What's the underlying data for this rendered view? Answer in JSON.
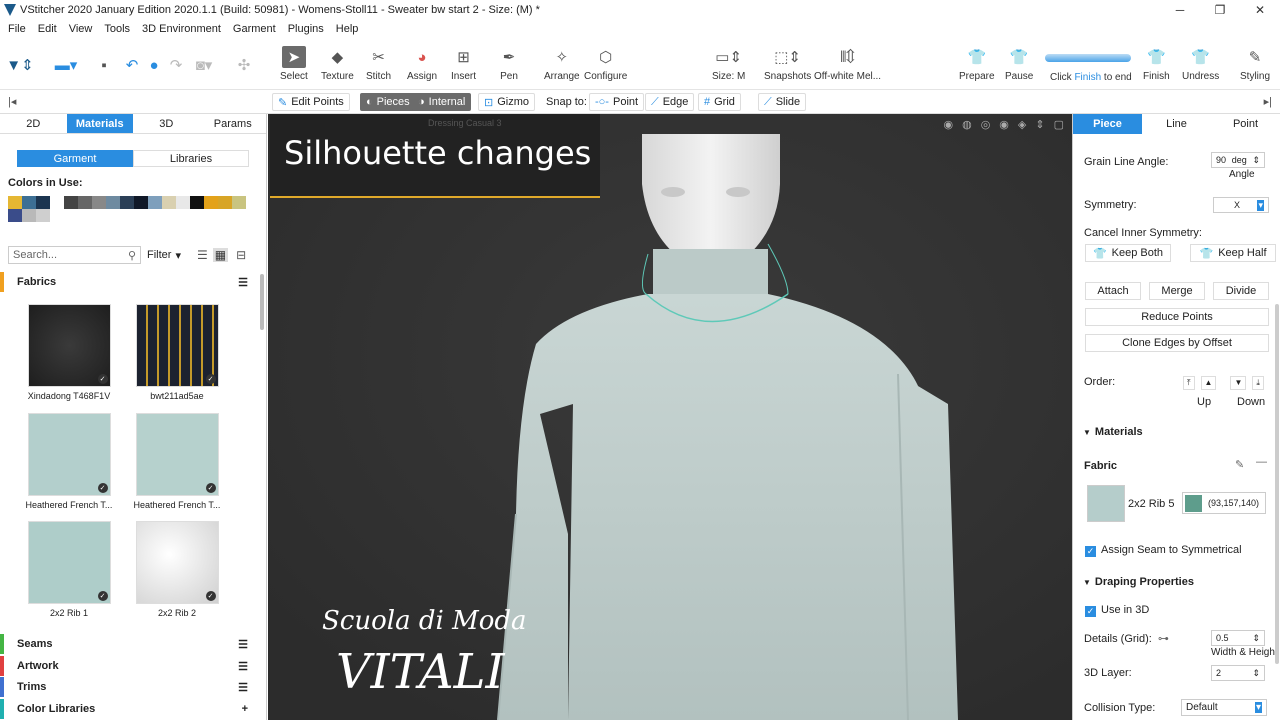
{
  "titlebar": {
    "title": "VStitcher 2020 January Edition 2020.1.1 (Build: 50981) - Womens-Stoll11 - Sweater bw start 2 - Size: (M) *",
    "minimize": "─",
    "maximize": "❐",
    "close": "✕"
  },
  "menu": [
    "File",
    "Edit",
    "View",
    "Tools",
    "3D Environment",
    "Garment",
    "Plugins",
    "Help"
  ],
  "toolbar": {
    "select": "Select",
    "texture": "Texture",
    "stitch": "Stitch",
    "assign": "Assign",
    "insert": "Insert",
    "pen": "Pen",
    "arrange": "Arrange",
    "configure": "Configure",
    "size": "Size: M",
    "snapshots": "Snapshots",
    "material": "Off-white Mel...",
    "prepare": "Prepare",
    "pause": "Pause",
    "click_prefix": "Click ",
    "click_finish": "Finish",
    "click_suffix": " to end",
    "finish": "Finish",
    "undress": "Undress",
    "styling": "Styling"
  },
  "subbar": {
    "edit_points": "Edit Points",
    "pieces": "Pieces",
    "internal": "Internal",
    "gizmo": "Gizmo",
    "snap_to": "Snap to:",
    "point": "Point",
    "edge": "Edge",
    "grid": "Grid",
    "slide": "Slide"
  },
  "left": {
    "tabs": [
      "2D",
      "Materials",
      "3D",
      "Params"
    ],
    "subtabs": [
      "Garment",
      "Libraries"
    ],
    "colors_in_use": "Colors in Use:",
    "swatches": [
      "#e5b733",
      "#3d6f94",
      "#1c3550",
      "#ffffff",
      "#444444",
      "#666666",
      "#888888",
      "#6e8aa0",
      "#2b3f57",
      "#101828",
      "#7e9fbc",
      "#d9d0b0",
      "#e8e8e8",
      "#111111",
      "#e3a21a",
      "#d8a526",
      "#c9c480",
      "#3a4c8a",
      "#b9b9b9",
      "#cfcfcf"
    ],
    "search_placeholder": "Search...",
    "filter": "Filter",
    "fabrics": "Fabrics",
    "items": [
      {
        "name": "Xindadong T468F1V"
      },
      {
        "name": "bwt211ad5ae"
      },
      {
        "name": "Heathered French T..."
      },
      {
        "name": "Heathered French T..."
      },
      {
        "name": "2x2 Rib 1"
      },
      {
        "name": "2x2 Rib 2"
      }
    ],
    "seams": "Seams",
    "artwork": "Artwork",
    "trims": "Trims",
    "color_libraries": "Color Libraries",
    "add": "+"
  },
  "viewport": {
    "overlay_title": "Silhouette changes",
    "dressing": "Dressing Casual 3",
    "brand_line1": "Scuola di Moda",
    "brand_line2": "VITALI"
  },
  "right": {
    "tabs": [
      "Piece",
      "Line",
      "Point"
    ],
    "grain_line_angle": "Grain Line Angle:",
    "angle_value": "90",
    "angle_unit": "deg",
    "angle_label": "Angle",
    "symmetry": "Symmetry:",
    "symmetry_value": "X",
    "cancel_inner": "Cancel Inner Symmetry:",
    "keep_both": "Keep Both",
    "keep_half": "Keep Half",
    "attach": "Attach",
    "merge": "Merge",
    "divide": "Divide",
    "reduce_points": "Reduce Points",
    "clone_edges": "Clone Edges by Offset",
    "order": "Order:",
    "up": "Up",
    "down": "Down",
    "materials": "Materials",
    "fabric": "Fabric",
    "fabric_name": "2x2 Rib 5",
    "fabric_color": "#5e9d8c",
    "fabric_rgb": "(93,157,140)",
    "assign_seam": "Assign Seam to Symmetrical",
    "draping": "Draping Properties",
    "use_in_3d": "Use in 3D",
    "details_grid": "Details (Grid):",
    "details_value": "0.5",
    "width_height": "Width & Height",
    "layer_3d": "3D Layer:",
    "layer_value": "2",
    "collision": "Collision Type:",
    "collision_value": "Default"
  }
}
